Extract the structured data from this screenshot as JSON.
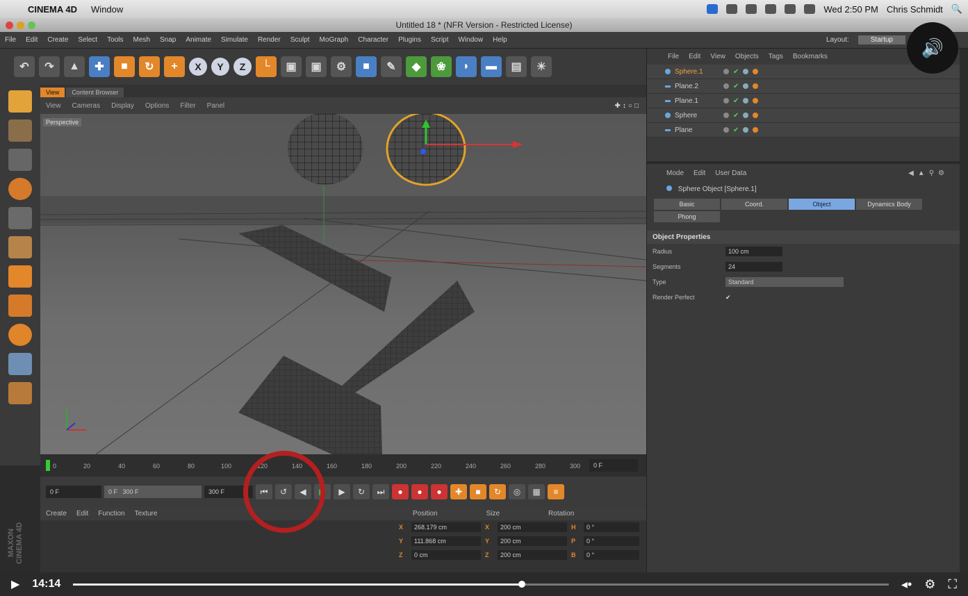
{
  "menubar": {
    "app_name": "CINEMA 4D",
    "window_menu": "Window",
    "clock": "Wed 2:50 PM",
    "user": "Chris Schmidt"
  },
  "titlebar": {
    "title": "Untitled 18 * (NFR Version - Restricted License)"
  },
  "app_menu": {
    "items": [
      "File",
      "Edit",
      "Create",
      "Select",
      "Tools",
      "Mesh",
      "Snap",
      "Animate",
      "Simulate",
      "Render",
      "Sculpt",
      "MoGraph",
      "Character",
      "Plugins",
      "Script",
      "Window",
      "Help"
    ],
    "layout_label": "Layout:",
    "layout_value": "Startup"
  },
  "toolbar": {
    "axis_x": "X",
    "axis_y": "Y",
    "axis_z": "Z"
  },
  "viewport": {
    "tabs": [
      "View",
      "Content Browser"
    ],
    "menu": [
      "View",
      "Cameras",
      "Display",
      "Options",
      "Filter",
      "Panel"
    ],
    "label": "Perspective"
  },
  "timeline": {
    "ticks": [
      "0",
      "20",
      "40",
      "60",
      "80",
      "100",
      "120",
      "140",
      "160",
      "180",
      "200",
      "220",
      "240",
      "260",
      "280",
      "300"
    ],
    "current_frame_field": "0 F"
  },
  "transport": {
    "start_field": "0 F",
    "range_field": "0 F",
    "end_field": "300 F",
    "end_range": "300 F"
  },
  "material_panel": {
    "menu": [
      "Create",
      "Edit",
      "Function",
      "Texture"
    ]
  },
  "coord_panel": {
    "headers": [
      "Position",
      "Size",
      "Rotation"
    ],
    "rows": [
      {
        "axis": "X",
        "pos": "268.179 cm",
        "size_axis": "X",
        "size": "200 cm",
        "rot_axis": "H",
        "rot": "0 °"
      },
      {
        "axis": "Y",
        "pos": "111.868 cm",
        "size_axis": "Y",
        "size": "200 cm",
        "rot_axis": "P",
        "rot": "0 °"
      },
      {
        "axis": "Z",
        "pos": "0 cm",
        "size_axis": "Z",
        "size": "200 cm",
        "rot_axis": "B",
        "rot": "0 °"
      }
    ]
  },
  "brand": "MAXON CINEMA 4D",
  "object_manager": {
    "menu": [
      "File",
      "Edit",
      "View",
      "Objects",
      "Tags",
      "Bookmarks"
    ],
    "objects": [
      {
        "name": "Sphere.1",
        "selected": true
      },
      {
        "name": "Plane.2",
        "selected": false
      },
      {
        "name": "Plane.1",
        "selected": false
      },
      {
        "name": "Sphere",
        "selected": false
      },
      {
        "name": "Plane",
        "selected": false
      }
    ]
  },
  "attribute_manager": {
    "menu": [
      "Mode",
      "Edit",
      "User Data"
    ],
    "object_title": "Sphere Object [Sphere.1]",
    "tabs": [
      "Basic",
      "Coord.",
      "Object",
      "Dynamics Body",
      "Phong"
    ],
    "active_tab": "Object",
    "section": "Object Properties",
    "props": [
      {
        "label": "Radius",
        "value": "100 cm"
      },
      {
        "label": "Segments",
        "value": "24"
      },
      {
        "label": "Type",
        "value": "Standard"
      },
      {
        "label": "Render Perfect",
        "value": "✔"
      }
    ]
  },
  "video": {
    "time": "14:14",
    "progress": 0.55
  },
  "colors": {
    "accent_orange": "#e2872a",
    "annotation_red": "#b41f1f",
    "selection_blue": "#7aa7e0"
  }
}
